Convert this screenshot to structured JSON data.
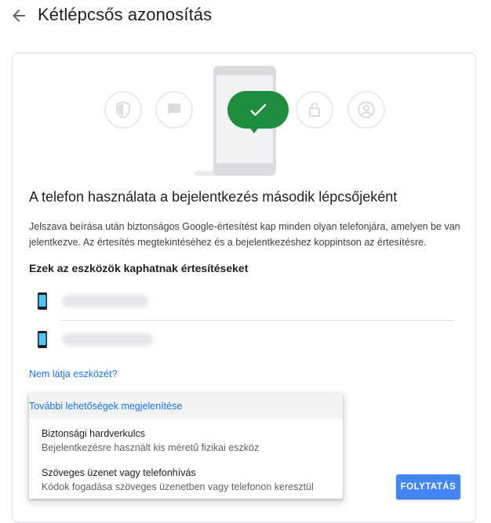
{
  "header": {
    "title": "Kétlépcsős azonosítás"
  },
  "hero": {
    "icons": [
      "shield-icon",
      "chat-icon",
      "checkmark-icon",
      "lock-icon",
      "account-icon"
    ],
    "accent_color": "#1e8e3e"
  },
  "main": {
    "heading": "A telefon használata a bejelentkezés második lépcsőjeként",
    "description": "Jelszava beírása után biztonságos Google-értesítést kap minden olyan telefonjára, amelyen be van jelentkezve. Az értesítés megtekintéséhez és a bejelentkezéshez koppintson az értesítésre.",
    "devices_heading": "Ezek az eszközök kaphatnak értesítéseket",
    "devices": [
      {
        "name": "████████"
      },
      {
        "name": "██████████"
      }
    ],
    "missing_device_link": "Nem látja eszközét?"
  },
  "more_options": {
    "header": "További lehetőségek megjelenítése",
    "items": [
      {
        "title": "Biztonsági hardverkulcs",
        "subtitle": "Bejelentkezésre használt kis méretű fizikai eszköz"
      },
      {
        "title": "Szöveges üzenet vagy telefonhívás",
        "subtitle": "Kódok fogadása szöveges üzenetben vagy telefonon keresztül"
      }
    ]
  },
  "actions": {
    "continue_label": "FOLYTATÁS"
  },
  "colors": {
    "primary": "#1a73e8",
    "button": "#4285f4"
  }
}
